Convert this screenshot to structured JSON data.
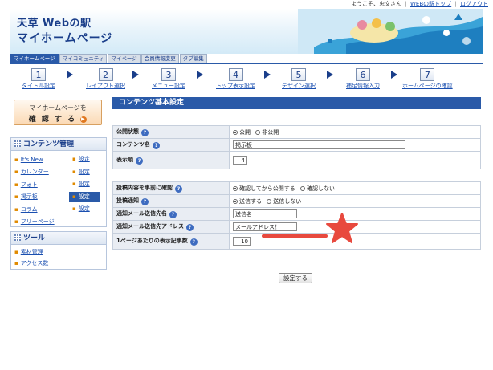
{
  "topbar": {
    "welcome": "ようこそ、忠文さん",
    "link_top": "WEBの駅トップ",
    "link_logout": "ログアウト"
  },
  "header": {
    "logo": "天草 Webの駅",
    "subtitle": "マイホームページ"
  },
  "tabs": [
    {
      "label": "マイホームページ",
      "active": true
    },
    {
      "label": "マイコミュニティ",
      "active": false
    },
    {
      "label": "マイページ",
      "active": false
    },
    {
      "label": "会員情報変更",
      "active": false
    },
    {
      "label": "タブ編集",
      "active": false
    }
  ],
  "steps": [
    {
      "num": "1",
      "label": "タイトル設定"
    },
    {
      "num": "2",
      "label": "レイアウト選択"
    },
    {
      "num": "3",
      "label": "メニュー設定"
    },
    {
      "num": "4",
      "label": "トップ表示設定"
    },
    {
      "num": "5",
      "label": "デザイン選択"
    },
    {
      "num": "6",
      "label": "補足情報入力"
    },
    {
      "num": "7",
      "label": "ホームページの確認"
    }
  ],
  "confirm_button": {
    "line1": "マイホームページを",
    "line2": "確 認 す る"
  },
  "content_panel": {
    "title": "コンテンツ管理",
    "items": [
      {
        "name": "It's New",
        "setting": "設定",
        "active": false
      },
      {
        "name": "カレンダー",
        "setting": "設定",
        "active": false
      },
      {
        "name": "フォト",
        "setting": "設定",
        "active": false
      },
      {
        "name": "掲示板",
        "setting": "設定",
        "active": true
      },
      {
        "name": "コラム",
        "setting": "設定",
        "active": false
      },
      {
        "name": "フリーページ",
        "setting": "",
        "active": false
      }
    ]
  },
  "tools_panel": {
    "title": "ツール",
    "items": [
      "素材管理",
      "アクセス数"
    ]
  },
  "main": {
    "title": "コンテンツ基本設定",
    "publish_status": {
      "label": "公開状態",
      "opt_public": "公開",
      "opt_private": "非公開"
    },
    "content_name": {
      "label": "コンテンツ名",
      "value": "掲示板"
    },
    "display_order": {
      "label": "表示順",
      "value": "4"
    },
    "pre_confirm": {
      "label": "投稿内容を事前に確認",
      "opt_confirm": "確認してから公開する",
      "opt_no": "確認しない"
    },
    "notify": {
      "label": "投稿通知",
      "opt_send": "送信する",
      "opt_nosend": "送信しない"
    },
    "mail_name": {
      "label": "通知メール送信先名",
      "value": "送信名"
    },
    "mail_address": {
      "label": "通知メール送信先アドレス",
      "value": "メールアドレス！"
    },
    "per_page": {
      "label": "1ページあたりの表示記事数",
      "value": "10"
    },
    "submit_label": "設定する"
  },
  "colors": {
    "primary": "#2a5aa8",
    "annotation": "#e8493e"
  }
}
